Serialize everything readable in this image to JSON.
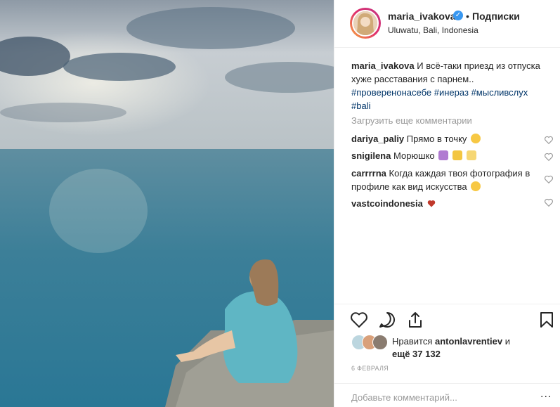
{
  "header": {
    "username": "maria_ivakova",
    "dot": "•",
    "follow_label": "Подписки",
    "location": "Uluwatu, Bali, Indonesia"
  },
  "caption": {
    "username": "maria_ivakova",
    "text": "И всё-таки приезд из отпуска хуже расставания с парнем..",
    "hashtags": [
      "#проверенонасебе",
      "#инераз",
      "#мысливслух",
      "#bali"
    ]
  },
  "load_more": "Загрузить еще комментарии",
  "comments": [
    {
      "username": "dariya_paliy",
      "text": "Прямо в точку"
    },
    {
      "username": "snigilena",
      "text": "Морюшко"
    },
    {
      "username": "carrrrna",
      "text": "Когда каждая твоя фотография в профиле как вид искусства"
    },
    {
      "username": "vastcoindonesia",
      "text": ""
    }
  ],
  "likes": {
    "prefix": "Нравится",
    "user": "antonlavrentiev",
    "conj": "и",
    "others": "ещё 37 132"
  },
  "date": "6 ФЕВРАЛЯ",
  "add_comment_placeholder": "Добавьте комментарий...",
  "more_label": "...",
  "icons": {
    "like": "heart-outline-icon",
    "comment": "comment-bubble-icon",
    "share": "share-icon",
    "save": "bookmark-icon",
    "verified": "verified-badge-icon"
  },
  "colors": {
    "link": "#003569",
    "verified": "#3897f0",
    "muted": "#999999",
    "red_heart": "#c0392b"
  }
}
